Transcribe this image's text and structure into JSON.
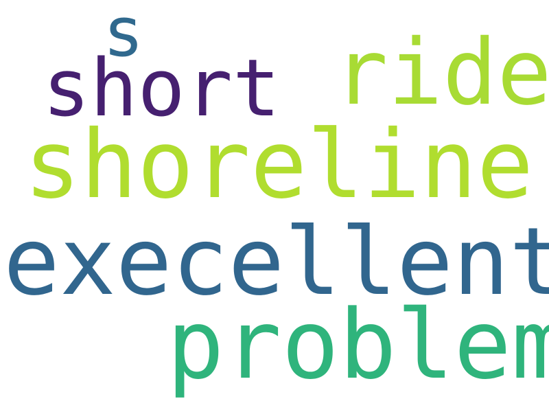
{
  "words": [
    {
      "text": "s",
      "color": "#30698e"
    },
    {
      "text": "ride",
      "color": "#a8db34"
    },
    {
      "text": "short",
      "color": "#462070"
    },
    {
      "text": "shoreline",
      "color": "#b0dd2f"
    },
    {
      "text": "execellent",
      "color": "#31668e"
    },
    {
      "text": "problem",
      "color": "#2fb47c"
    }
  ]
}
